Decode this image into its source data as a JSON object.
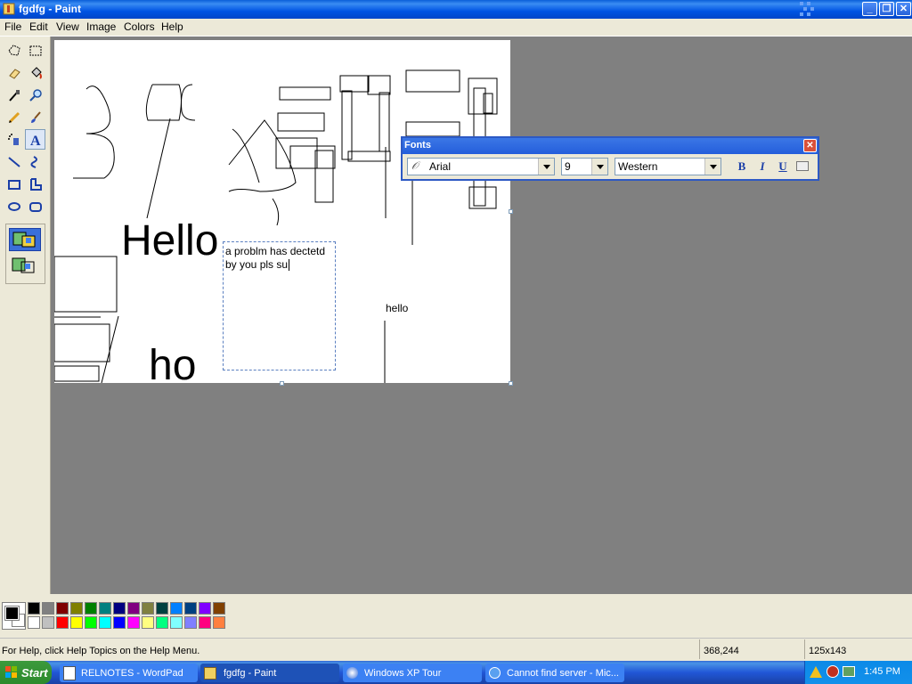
{
  "window": {
    "title": "fgdfg - Paint",
    "minimize": "_",
    "restore": "❐",
    "close": "✕"
  },
  "menu": {
    "items": [
      {
        "label": "File"
      },
      {
        "label": "Edit"
      },
      {
        "label": "View"
      },
      {
        "label": "Image"
      },
      {
        "label": "Colors"
      },
      {
        "label": "Help"
      }
    ]
  },
  "tools": [
    {
      "name": "free-form-select-icon"
    },
    {
      "name": "select-icon"
    },
    {
      "name": "eraser-icon"
    },
    {
      "name": "fill-icon"
    },
    {
      "name": "pick-color-icon"
    },
    {
      "name": "magnifier-icon"
    },
    {
      "name": "pencil-icon"
    },
    {
      "name": "brush-icon"
    },
    {
      "name": "airbrush-icon"
    },
    {
      "name": "text-icon"
    },
    {
      "name": "line-icon"
    },
    {
      "name": "curve-icon"
    },
    {
      "name": "rectangle-icon"
    },
    {
      "name": "polygon-icon"
    },
    {
      "name": "ellipse-icon"
    },
    {
      "name": "rounded-rectangle-icon"
    }
  ],
  "selected_tool": "text-icon",
  "canvas": {
    "text_hello_large": "Hello",
    "text_partial": "ho",
    "text_hello_small": "hello",
    "textbox_line1": "a problm has dectetd",
    "textbox_line2": "by you pls su"
  },
  "fonts_toolbar": {
    "title": "Fonts",
    "font_name": "Arial",
    "font_size": "9",
    "script": "Western",
    "bold_label": "B",
    "italic_label": "I",
    "underline_label": "U"
  },
  "palette": {
    "foreground": "#000000",
    "background": "#ffffff",
    "colors_top": [
      "#000000",
      "#808080",
      "#800000",
      "#808000",
      "#008000",
      "#008080",
      "#000080",
      "#800080",
      "#808040",
      "#004040",
      "#0080ff",
      "#004080",
      "#8000ff",
      "#804000"
    ],
    "colors_bottom": [
      "#ffffff",
      "#c0c0c0",
      "#ff0000",
      "#ffff00",
      "#00ff00",
      "#00ffff",
      "#0000ff",
      "#ff00ff",
      "#ffff80",
      "#00ff80",
      "#80ffff",
      "#8080ff",
      "#ff0080",
      "#ff8040"
    ]
  },
  "status": {
    "help_text": "For Help, click Help Topics on the Help Menu.",
    "coords": "368,244",
    "size": "125x143"
  },
  "taskbar": {
    "start_label": "Start",
    "tasks": [
      {
        "label": "RELNOTES - WordPad",
        "active": false
      },
      {
        "label": "fgdfg - Paint",
        "active": true
      },
      {
        "label": "Windows XP Tour",
        "active": false
      },
      {
        "label": "Cannot find server - Mic...",
        "active": false
      }
    ],
    "clock": "1:45 PM"
  }
}
